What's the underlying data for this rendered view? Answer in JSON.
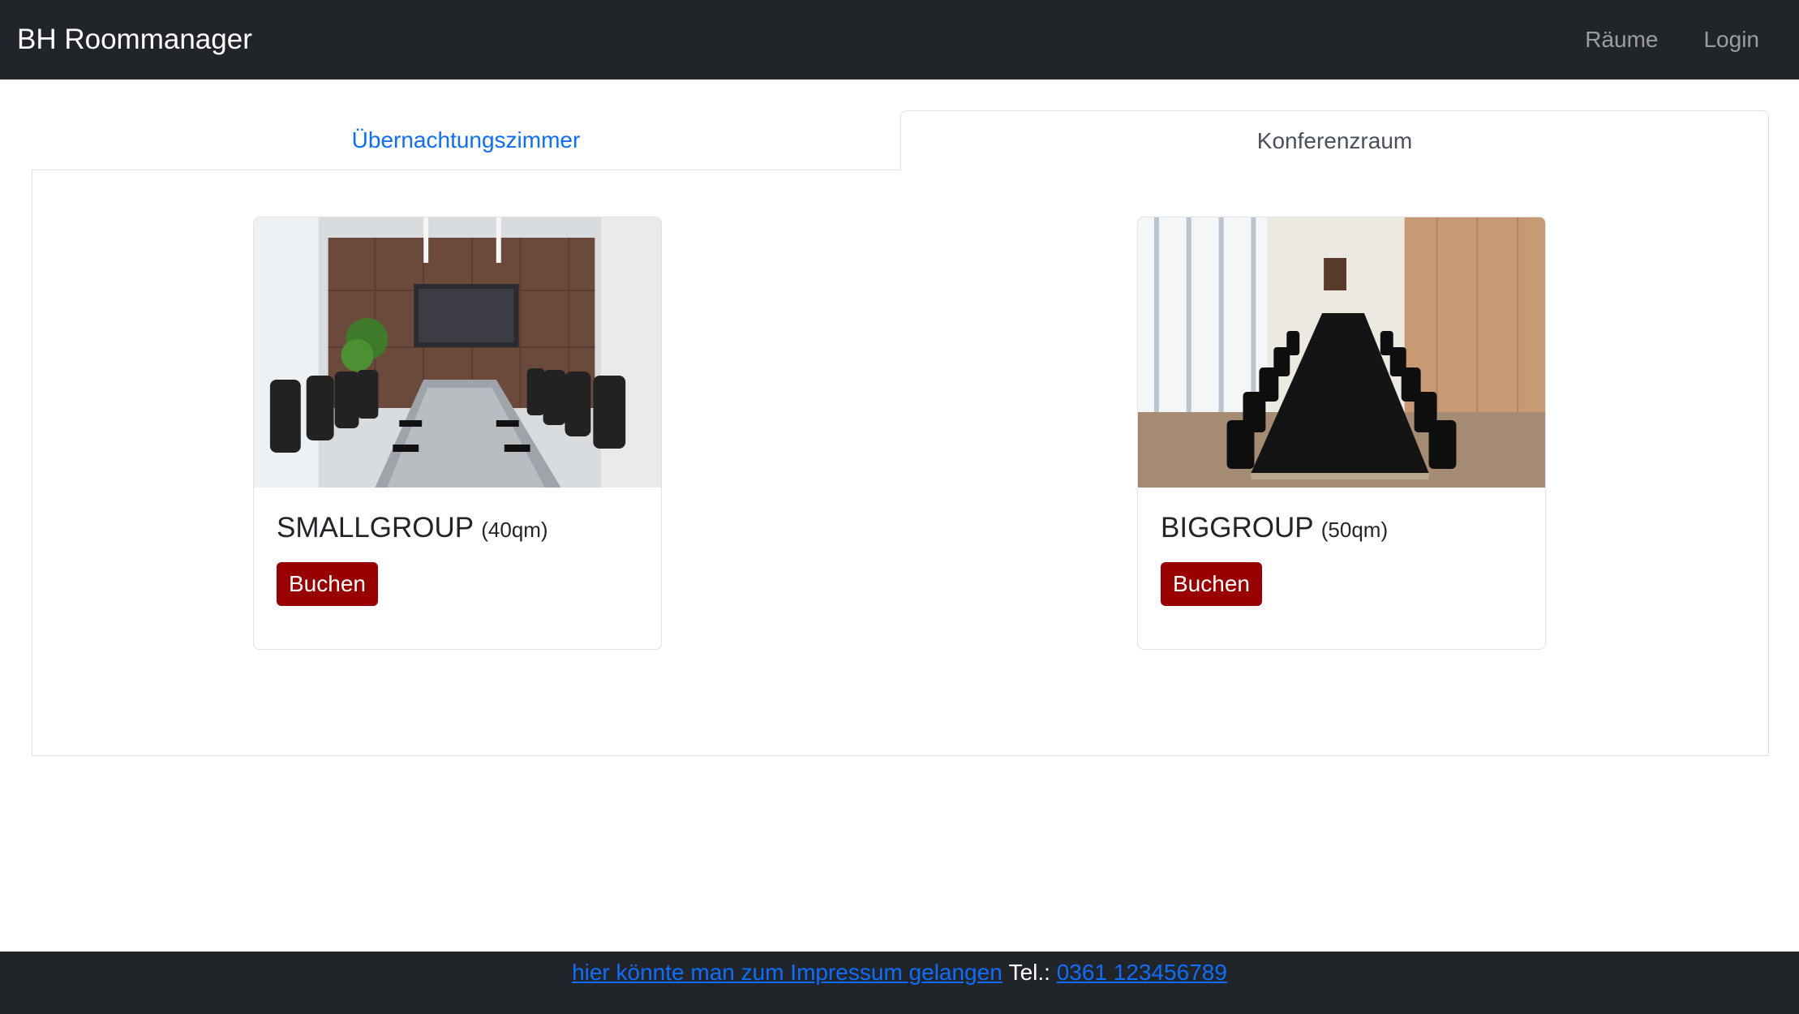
{
  "navbar": {
    "brand": "BH Roommanager",
    "links": [
      {
        "label": "Räume"
      },
      {
        "label": "Login"
      }
    ]
  },
  "tabs": [
    {
      "label": "Übernachtungszimmer",
      "active": false
    },
    {
      "label": "Konferenzraum",
      "active": true
    }
  ],
  "rooms": [
    {
      "name": "SMALLGROUP",
      "size": "(40qm)",
      "button": "Buchen"
    },
    {
      "name": "BIGGROUP",
      "size": "(50qm)",
      "button": "Buchen"
    }
  ],
  "footer": {
    "impressum_link": "hier könnte man zum Impressum gelangen",
    "tel_label": "Tel.:",
    "phone_link": "0361 123456789"
  },
  "colors": {
    "navbar_bg": "#212529",
    "link_blue": "#0d6efd",
    "book_button": "#990000"
  }
}
